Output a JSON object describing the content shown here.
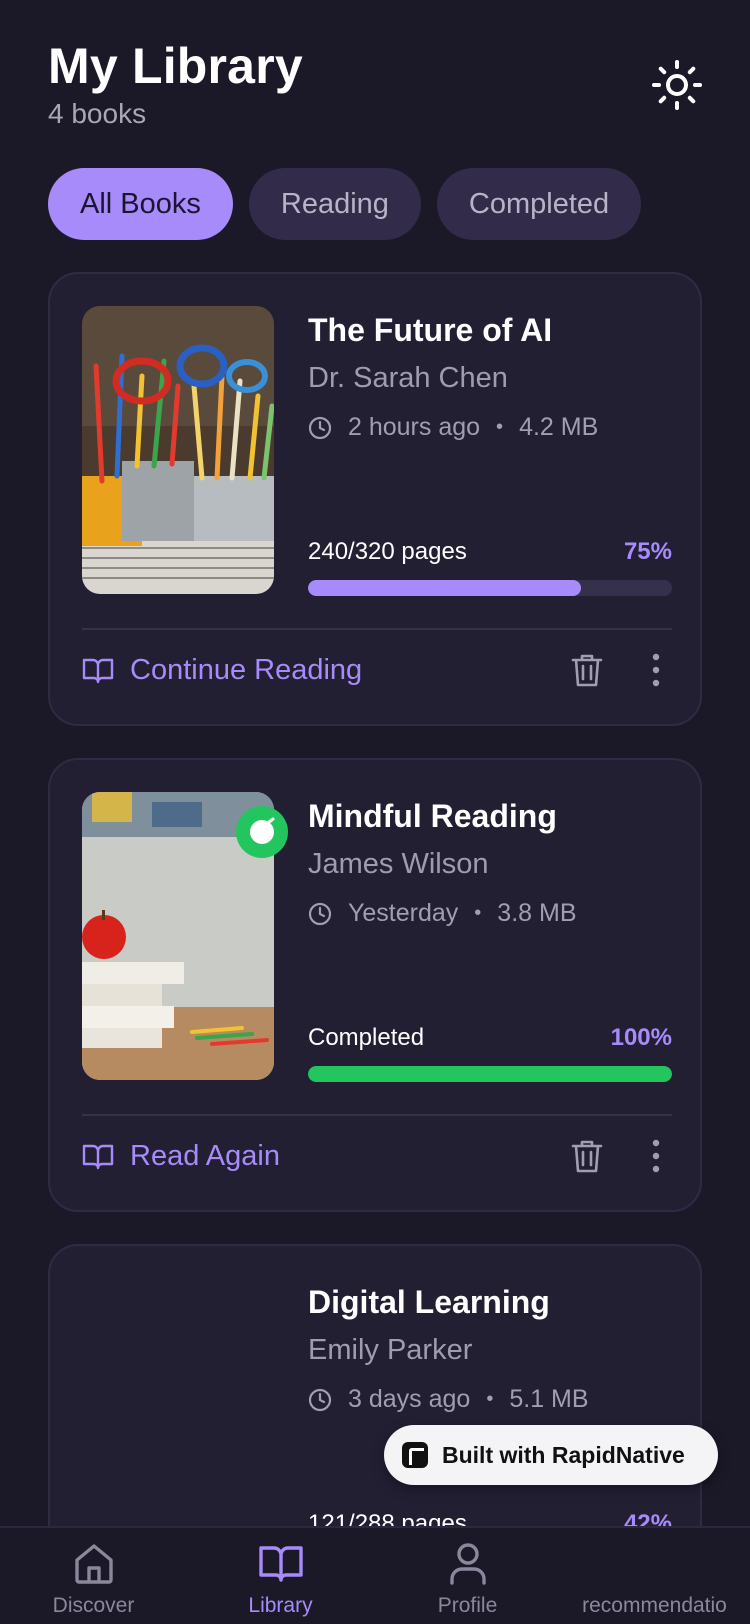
{
  "header": {
    "title": "My Library",
    "count": "4 books"
  },
  "tabs": [
    {
      "label": "All Books",
      "active": true
    },
    {
      "label": "Reading",
      "active": false
    },
    {
      "label": "Completed",
      "active": false
    }
  ],
  "books": [
    {
      "title": "The Future of AI",
      "author": "Dr. Sarah Chen",
      "time": "2 hours ago",
      "size": "4.2 MB",
      "progress_label": "240/320 pages",
      "progress_pct": "75%",
      "progress": 0.75,
      "bar_color": "#a78bfa",
      "action": "Continue Reading",
      "cover": "pencil-cups-photo"
    },
    {
      "title": "Mindful Reading",
      "author": "James Wilson",
      "time": "Yesterday",
      "size": "3.8 MB",
      "progress_label": "Completed",
      "progress_pct": "100%",
      "progress": 1.0,
      "bar_color": "#22c55e",
      "action": "Read Again",
      "cover": "apple-books-photo"
    },
    {
      "title": "Digital Learning",
      "author": "Emily Parker",
      "time": "3 days ago",
      "size": "5.1 MB",
      "progress_label": "121/288 pages",
      "progress_pct": "42%",
      "progress": 0.42,
      "bar_color": "#a78bfa"
    }
  ],
  "badge": {
    "label": "Built with RapidNative"
  },
  "nav": [
    {
      "label": "Discover",
      "icon": "home-icon",
      "active": false
    },
    {
      "label": "Library",
      "icon": "book-icon",
      "active": true
    },
    {
      "label": "Profile",
      "icon": "user-icon",
      "active": false
    },
    {
      "label": "recommendatio",
      "icon": "",
      "active": false
    }
  ],
  "colors": {
    "background": "#1b1828",
    "card": "#221f33",
    "accent": "#a78bfa",
    "success": "#22c55e"
  }
}
